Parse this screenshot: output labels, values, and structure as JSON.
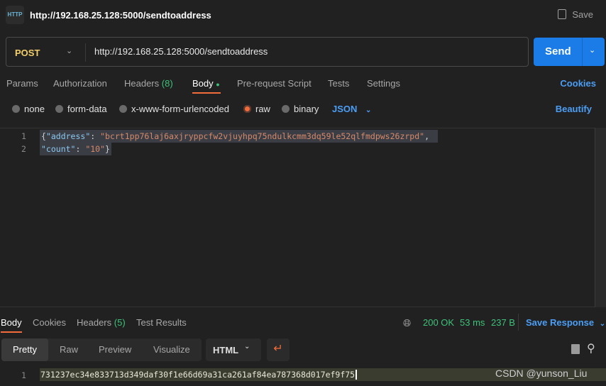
{
  "header": {
    "icon_text": "HTTP",
    "title": "http://192.168.25.128:5000/sendtoaddress",
    "save_label": "Save"
  },
  "request": {
    "method": "POST",
    "url": "http://192.168.25.128:5000/sendtoaddress",
    "send_label": "Send"
  },
  "tabs": {
    "params": "Params",
    "authorization": "Authorization",
    "headers": "Headers",
    "headers_count": "(8)",
    "body": "Body",
    "prerequest": "Pre-request Script",
    "tests": "Tests",
    "settings": "Settings",
    "cookies": "Cookies"
  },
  "body_types": {
    "none": "none",
    "form_data": "form-data",
    "urlencoded": "x-www-form-urlencoded",
    "raw": "raw",
    "binary": "binary",
    "format": "JSON",
    "beautify": "Beautify",
    "selected": "raw"
  },
  "editor": {
    "lines": [
      {
        "n": "1",
        "open": "{",
        "key": "\"address\"",
        "colon": ": ",
        "value": "\"bcrt1pp76laj6axjryppcfw2vjuyhpq75ndulkcmm3dq59le52qlfmdpws26zrpd\"",
        "end": ","
      },
      {
        "n": "2",
        "key": "\"count\"",
        "colon": ": ",
        "value": "\"10\"",
        "end": "}"
      }
    ]
  },
  "response": {
    "tabs": {
      "body": "Body",
      "cookies": "Cookies",
      "headers": "Headers",
      "headers_count": "(5)",
      "test_results": "Test Results"
    },
    "status": "200 OK",
    "time": "53 ms",
    "size": "237 B",
    "save_response": "Save Response",
    "views": {
      "pretty": "Pretty",
      "raw": "Raw",
      "preview": "Preview",
      "visualize": "Visualize"
    },
    "format": "HTML",
    "line_number": "1",
    "body": "731237ec34e833713d349daf30f1e66d69a31ca261af84ea787368d017ef9f75"
  },
  "watermark": "CSDN @yunson_Liu"
}
